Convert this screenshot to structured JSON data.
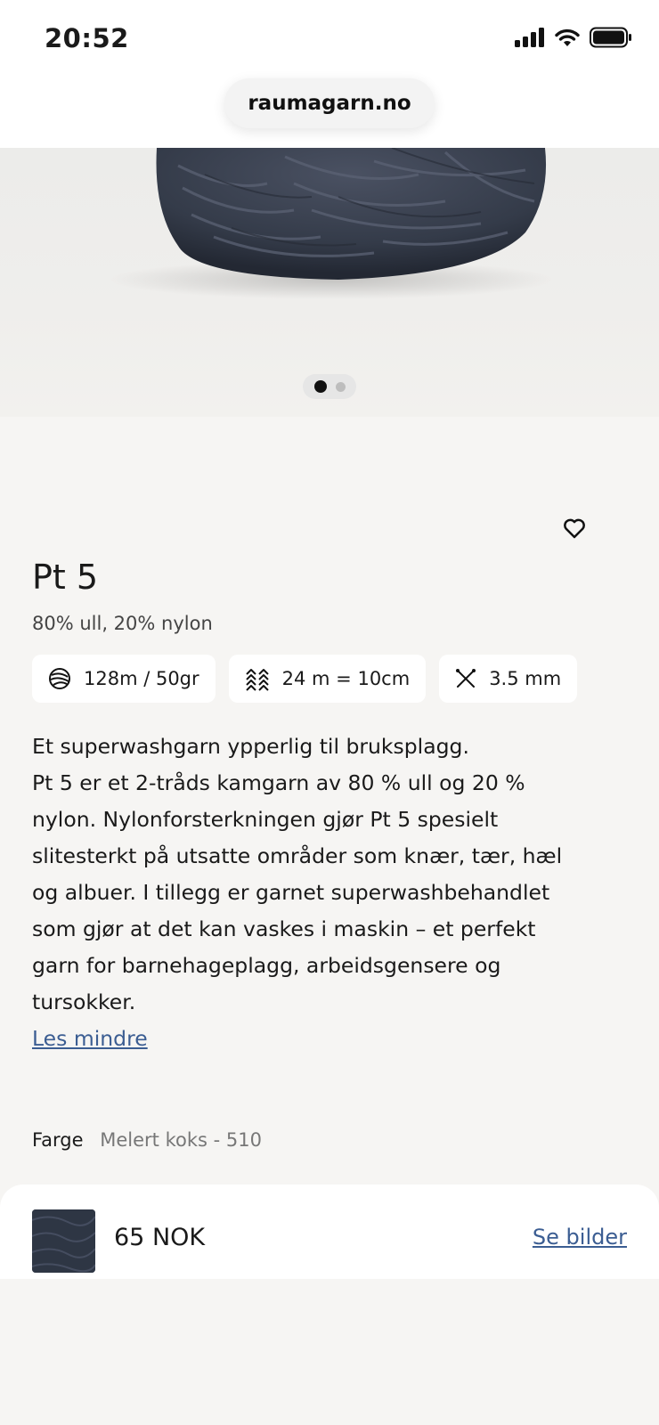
{
  "status_bar": {
    "time": "20:52"
  },
  "browser": {
    "url": "raumagarn.no"
  },
  "gallery": {
    "total_images": 2,
    "active_index": 1
  },
  "product": {
    "title": "Pt 5",
    "composition": "80% ull, 20% nylon",
    "specs": [
      {
        "icon": "yarn-ball-icon",
        "text": "128m / 50gr"
      },
      {
        "icon": "gauge-icon",
        "text": "24 m = 10cm"
      },
      {
        "icon": "needles-icon",
        "text": "3.5 mm"
      }
    ],
    "description_lines": [
      "Et superwashgarn ypperlig til bruksplagg.",
      "Pt 5 er et 2-tråds kamgarn av 80 % ull og 20 %",
      "nylon. Nylonforsterkningen gjør Pt 5 spesielt",
      "slitesterkt på utsatte områder som knær, tær, hæl",
      "og albuer. I tillegg er garnet superwashbehandlet",
      "som gjør at det kan vaskes i maskin – et perfekt",
      "garn for barnehageplagg, arbeidsgensere og",
      "tursokker."
    ],
    "toggle_label": "Les mindre",
    "color_label": "Farge",
    "color_value": "Melert koks - 510"
  },
  "purchase_bar": {
    "price": "65 NOK",
    "see_images_label": "Se bilder",
    "swatch_color": "#2e3644"
  },
  "colors": {
    "link": "#3b5d92",
    "background": "#f6f5f3"
  }
}
